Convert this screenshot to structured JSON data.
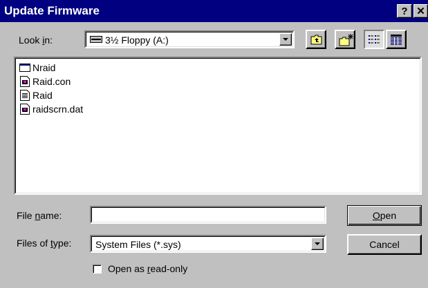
{
  "window": {
    "title": "Update Firmware",
    "help_label": "?",
    "close_label": "✕"
  },
  "look_in": {
    "label_pre": "Look ",
    "label_u": "i",
    "label_post": "n:",
    "value": "3½ Floppy (A:)",
    "icon": "floppy-drive-icon"
  },
  "toolbar": {
    "up_icon": "up-folder-icon",
    "new_folder_icon": "new-folder-icon",
    "list_icon": "list-view-icon",
    "details_icon": "details-view-icon"
  },
  "files": [
    {
      "name": "Nraid",
      "icon": "window-app-icon"
    },
    {
      "name": "Raid.con",
      "icon": "system-file-icon"
    },
    {
      "name": "Raid",
      "icon": "text-file-icon"
    },
    {
      "name": "raidscrn.dat",
      "icon": "system-file-icon"
    }
  ],
  "file_name": {
    "label_pre": "File ",
    "label_u": "n",
    "label_post": "ame:",
    "value": ""
  },
  "file_type": {
    "label_pre": "Files of ",
    "label_u": "t",
    "label_post": "ype:",
    "value": "System Files (*.sys)"
  },
  "buttons": {
    "open_u": "O",
    "open_rest": "pen",
    "cancel": "Cancel"
  },
  "readonly": {
    "label_pre": "Open as ",
    "label_u": "r",
    "label_post": "ead-only",
    "checked": false
  },
  "colors": {
    "titlebar": "#000080",
    "face": "#c0c0c0"
  }
}
